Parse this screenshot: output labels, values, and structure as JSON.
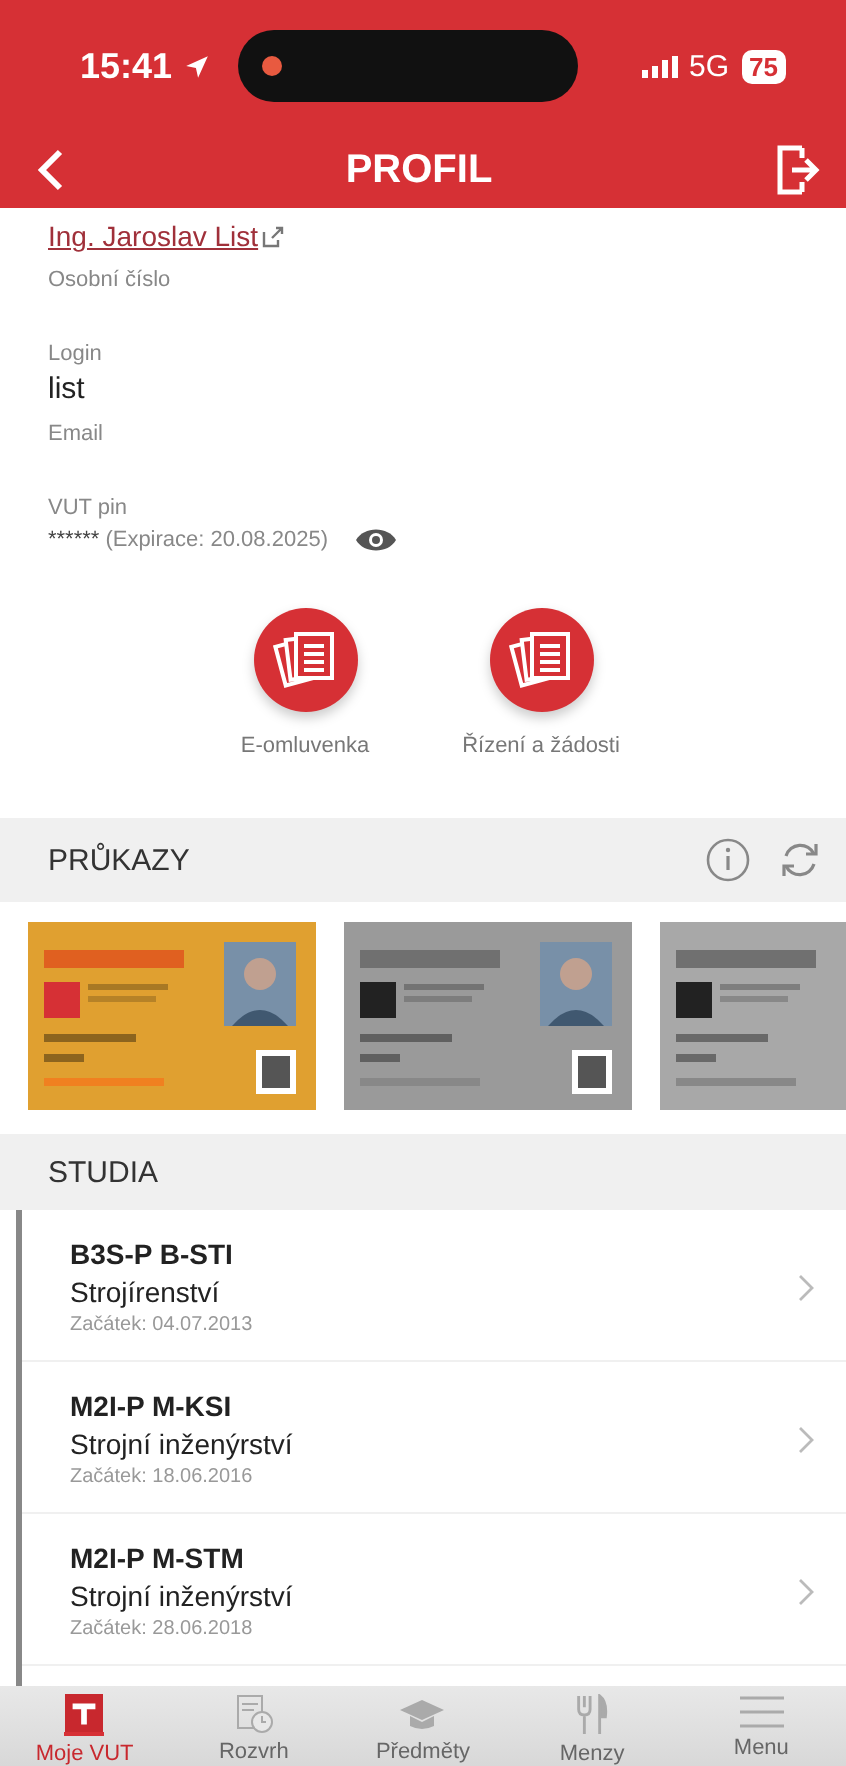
{
  "status_bar": {
    "time": "15:41",
    "network": "5G",
    "battery": "75"
  },
  "header": {
    "title": "PROFIL"
  },
  "fields": [
    {
      "kind": "link",
      "value": "Ing. Jaroslav List"
    },
    {
      "kind": "plain",
      "label": "Osobní číslo"
    },
    {
      "kind": "plain",
      "label": "Login",
      "value": "list"
    },
    {
      "kind": "plain",
      "label": "Email"
    },
    {
      "kind": "pin",
      "label": "VUT pin",
      "value": "******",
      "note": "(Expirace: 20.08.2025)"
    }
  ],
  "actions": [
    {
      "label": "E-omluvenka"
    },
    {
      "label": "Řízení a žádosti"
    }
  ],
  "cards_section": {
    "title": "PRŮKAZY"
  },
  "studies_section": {
    "title": "STUDIA",
    "rows": [
      {
        "code": "B3S-P  B-STI",
        "name": "Strojírenství",
        "start": "Začátek: 04.07.2013"
      },
      {
        "code": "M2I-P  M-KSI",
        "name": "Strojní inženýrství",
        "start": "Začátek: 18.06.2016"
      },
      {
        "code": "M2I-P  M-STM",
        "name": "Strojní inženýrství",
        "start": "Začátek: 28.06.2018"
      }
    ]
  },
  "tab_bar": [
    {
      "kind": "logo",
      "label": "Moje VUT",
      "selected": true
    },
    {
      "kind": "calendar",
      "label": "Rozvrh",
      "selected": false
    },
    {
      "kind": "cap",
      "label": "Předměty",
      "selected": false
    },
    {
      "kind": "food",
      "label": "Menzy",
      "selected": false
    },
    {
      "kind": "menu",
      "label": "Menu",
      "selected": false
    }
  ]
}
